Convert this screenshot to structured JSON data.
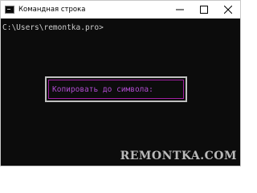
{
  "window": {
    "title": "Командная строка"
  },
  "console": {
    "prompt": "C:\\Users\\remontka.pro>"
  },
  "dialog": {
    "label": "Копировать до символа:"
  },
  "watermark": {
    "text": "REMONTKA.COM"
  },
  "icons": {
    "app": "cmd-icon",
    "minimize": "minimize-icon",
    "maximize": "maximize-icon",
    "close": "close-icon"
  },
  "colors": {
    "console_bg": "#0c0c0c",
    "console_text": "#cccccc",
    "dialog_text": "#b04cd0",
    "dialog_border": "#a020a0"
  }
}
